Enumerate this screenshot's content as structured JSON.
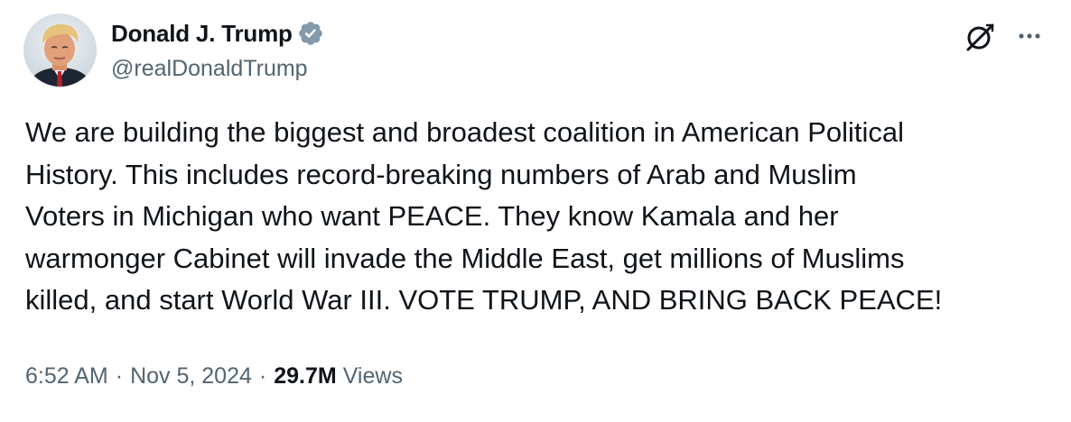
{
  "author": {
    "display_name": "Donald J. Trump",
    "handle": "@realDonaldTrump",
    "verified": true,
    "verified_badge_color": "#829aab"
  },
  "icons": {
    "avatar": "profile-photo",
    "verified": "verified-badge-icon",
    "grok": "grok-icon",
    "more": "more-icon"
  },
  "tweet": {
    "text": "We are building the biggest and broadest coalition in American Political\nHistory. This includes record-breaking numbers of Arab and Muslim\nVoters in Michigan who want PEACE. They know Kamala and her\nwarmonger Cabinet will invade the Middle East, get millions of Muslims\nkilled, and start World War III. VOTE TRUMP, AND BRING BACK PEACE!"
  },
  "meta": {
    "time": "6:52 AM",
    "separator": "·",
    "date": "Nov 5, 2024",
    "views_count": "29.7M",
    "views_label": "Views"
  },
  "colors": {
    "text_primary": "#0f1419",
    "text_secondary": "#536471",
    "background": "#ffffff"
  }
}
